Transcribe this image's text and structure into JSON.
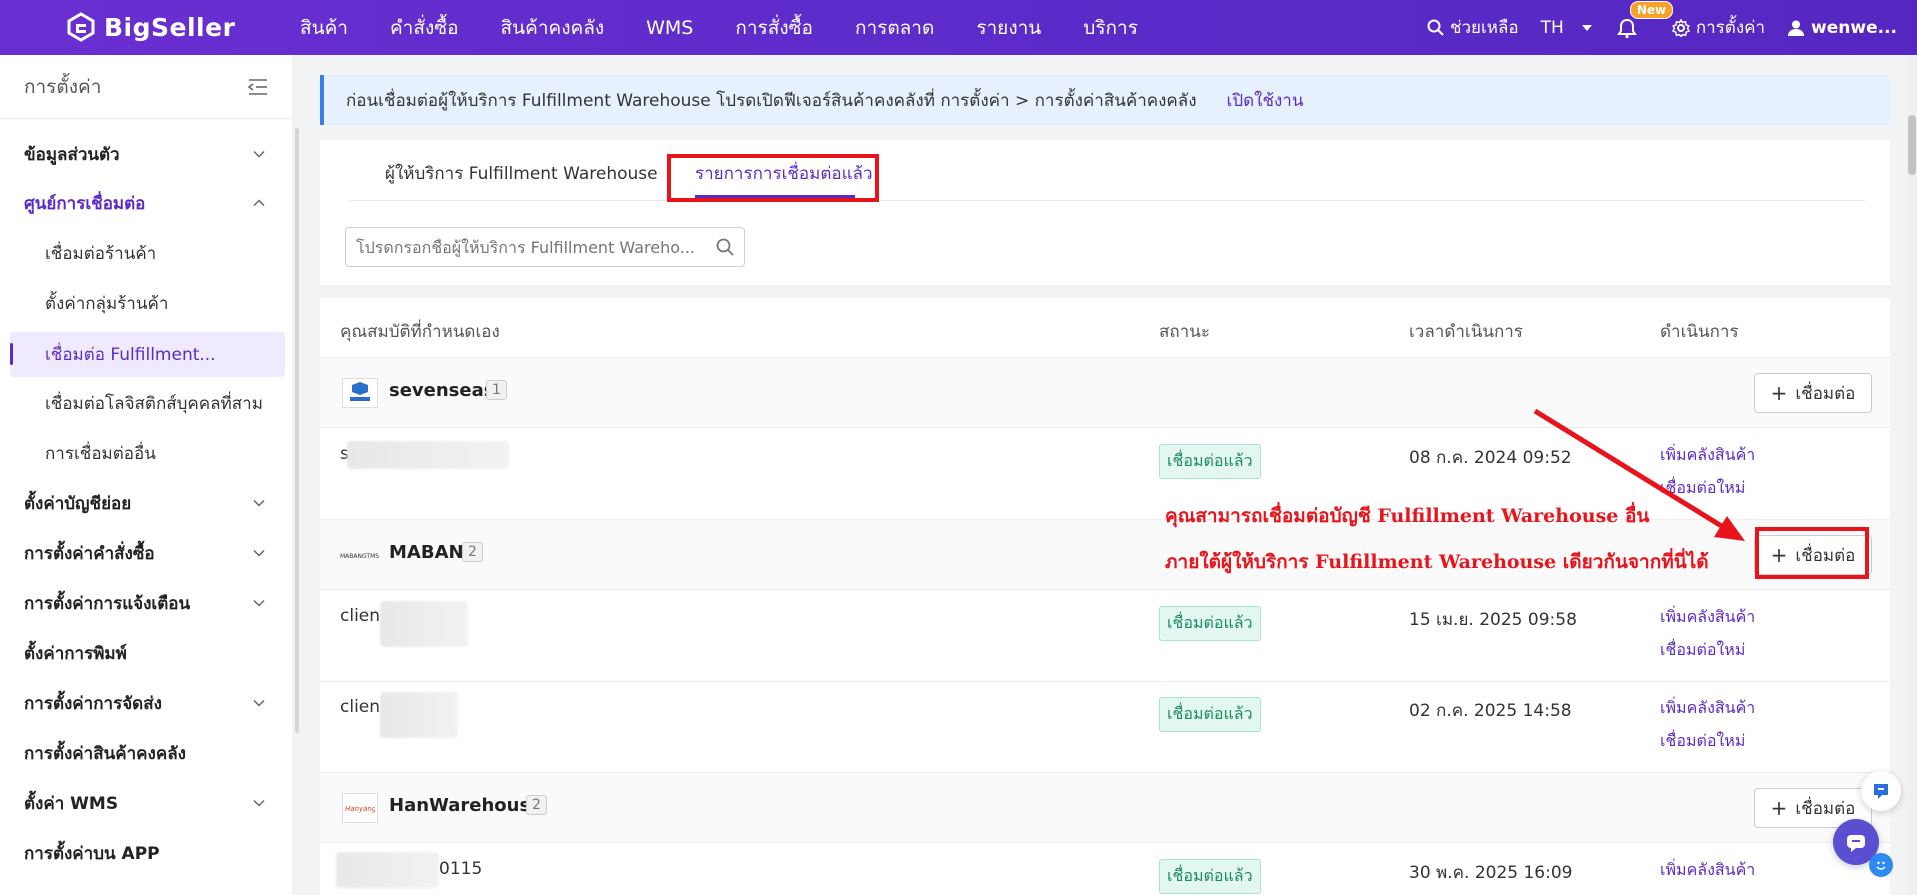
{
  "app": {
    "logo_text": "BigSeller",
    "brand_color": "#5b2bc9"
  },
  "nav": {
    "items": [
      "สินค้า",
      "คำสั่งซื้อ",
      "สินค้าคงคลัง",
      "WMS",
      "การสั่งซื้อ",
      "การตลาด",
      "รายงาน",
      "บริการ"
    ],
    "help": "ช่วยเหลือ",
    "lang": "TH",
    "new_badge": "New",
    "settings": "การตั้งค่า",
    "user": "wenwe..."
  },
  "sidebar": {
    "title": "การตั้งค่า",
    "items": [
      {
        "label": "ข้อมูลส่วนตัว"
      },
      {
        "label": "ศูนย์การเชื่อมต่อ"
      },
      {
        "label": "เชื่อมต่อร้านค้า"
      },
      {
        "label": "ตั้งค่ากลุ่มร้านค้า"
      },
      {
        "label": "เชื่อมต่อ Fulfillment..."
      },
      {
        "label": "เชื่อมต่อโลจิสติกส์บุคคลที่สาม"
      },
      {
        "label": "การเชื่อมต่ออื่น"
      },
      {
        "label": "ตั้งค่าบัญชีย่อย"
      },
      {
        "label": "การตั้งค่าคำสั่งซื้อ"
      },
      {
        "label": "การตั้งค่าการแจ้งเตือน"
      },
      {
        "label": "ตั้งค่าการพิมพ์"
      },
      {
        "label": "การตั้งค่าการจัดส่ง"
      },
      {
        "label": "การตั้งค่าสินค้าคงคลัง"
      },
      {
        "label": "ตั้งค่า WMS"
      },
      {
        "label": "การตั้งค่าบน APP"
      }
    ]
  },
  "notice": {
    "text": "ก่อนเชื่อมต่อผู้ให้บริการ Fulfillment Warehouse โปรดเปิดฟีเจอร์สินค้าคงคลังที่ การตั้งค่า > การตั้งค่าสินค้าคงคลัง",
    "link": "เปิดใช้งาน"
  },
  "tabs": {
    "providers": "ผู้ให้บริการ Fulfillment Warehouse",
    "connected": "รายการการเชื่อมต่อแล้ว"
  },
  "search": {
    "placeholder": "โปรดกรอกชื่อผู้ให้บริการ Fulfillment Wareho..."
  },
  "table": {
    "headers": {
      "custom": "คุณสมบัติที่กำหนดเอง",
      "status": "สถานะ",
      "time": "เวลาดำเนินการ",
      "action": "ดำเนินการ"
    },
    "connect_label": "เชื่อมต่อ",
    "status_connected": "เชื่อมต่อแล้ว",
    "action_add_warehouse": "เพิ่มคลังสินค้า",
    "action_reconnect": "เชื่อมต่อใหม่",
    "groups": [
      {
        "name": "sevenseas",
        "count": "1"
      },
      {
        "name": "MABAN",
        "count": "2"
      },
      {
        "name": "HanWarehouse",
        "count": "2"
      }
    ],
    "rows": [
      {
        "name": "s",
        "time": "08 ก.ค. 2024 09:52"
      },
      {
        "name": "clien",
        "time": "15 เม.ย. 2025 09:58"
      },
      {
        "name": "clien",
        "time": "02 ก.ค. 2025 14:58"
      },
      {
        "name": "0115",
        "time": "30 พ.ค. 2025 16:09"
      }
    ]
  },
  "annotation": {
    "line1": "คุณสามารถเชื่อมต่อบัญชี Fulfillment Warehouse อื่น",
    "line2": "ภายใต้ผู้ให้บริการ  Fulfillment Warehouse เดียวกันจากที่นี่ได้",
    "color": "#e8131b"
  }
}
